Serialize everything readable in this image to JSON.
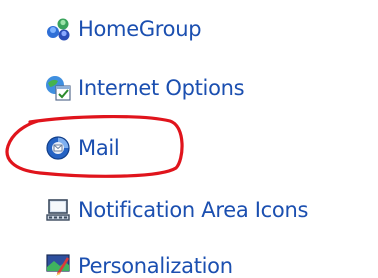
{
  "control_panel": {
    "items": [
      {
        "label": "HomeGroup",
        "icon": "homegroup-icon"
      },
      {
        "label": "Internet Options",
        "icon": "internet-options-icon"
      },
      {
        "label": "Mail",
        "icon": "mail-icon"
      },
      {
        "label": "Notification Area Icons",
        "icon": "notification-area-icon"
      },
      {
        "label": "Personalization",
        "icon": "personalization-icon"
      }
    ]
  },
  "annotation": {
    "highlight_color": "#e0141c",
    "highlighted_item": "Mail"
  },
  "colors": {
    "link_text": "#1b4fb0",
    "background": "#ffffff"
  }
}
